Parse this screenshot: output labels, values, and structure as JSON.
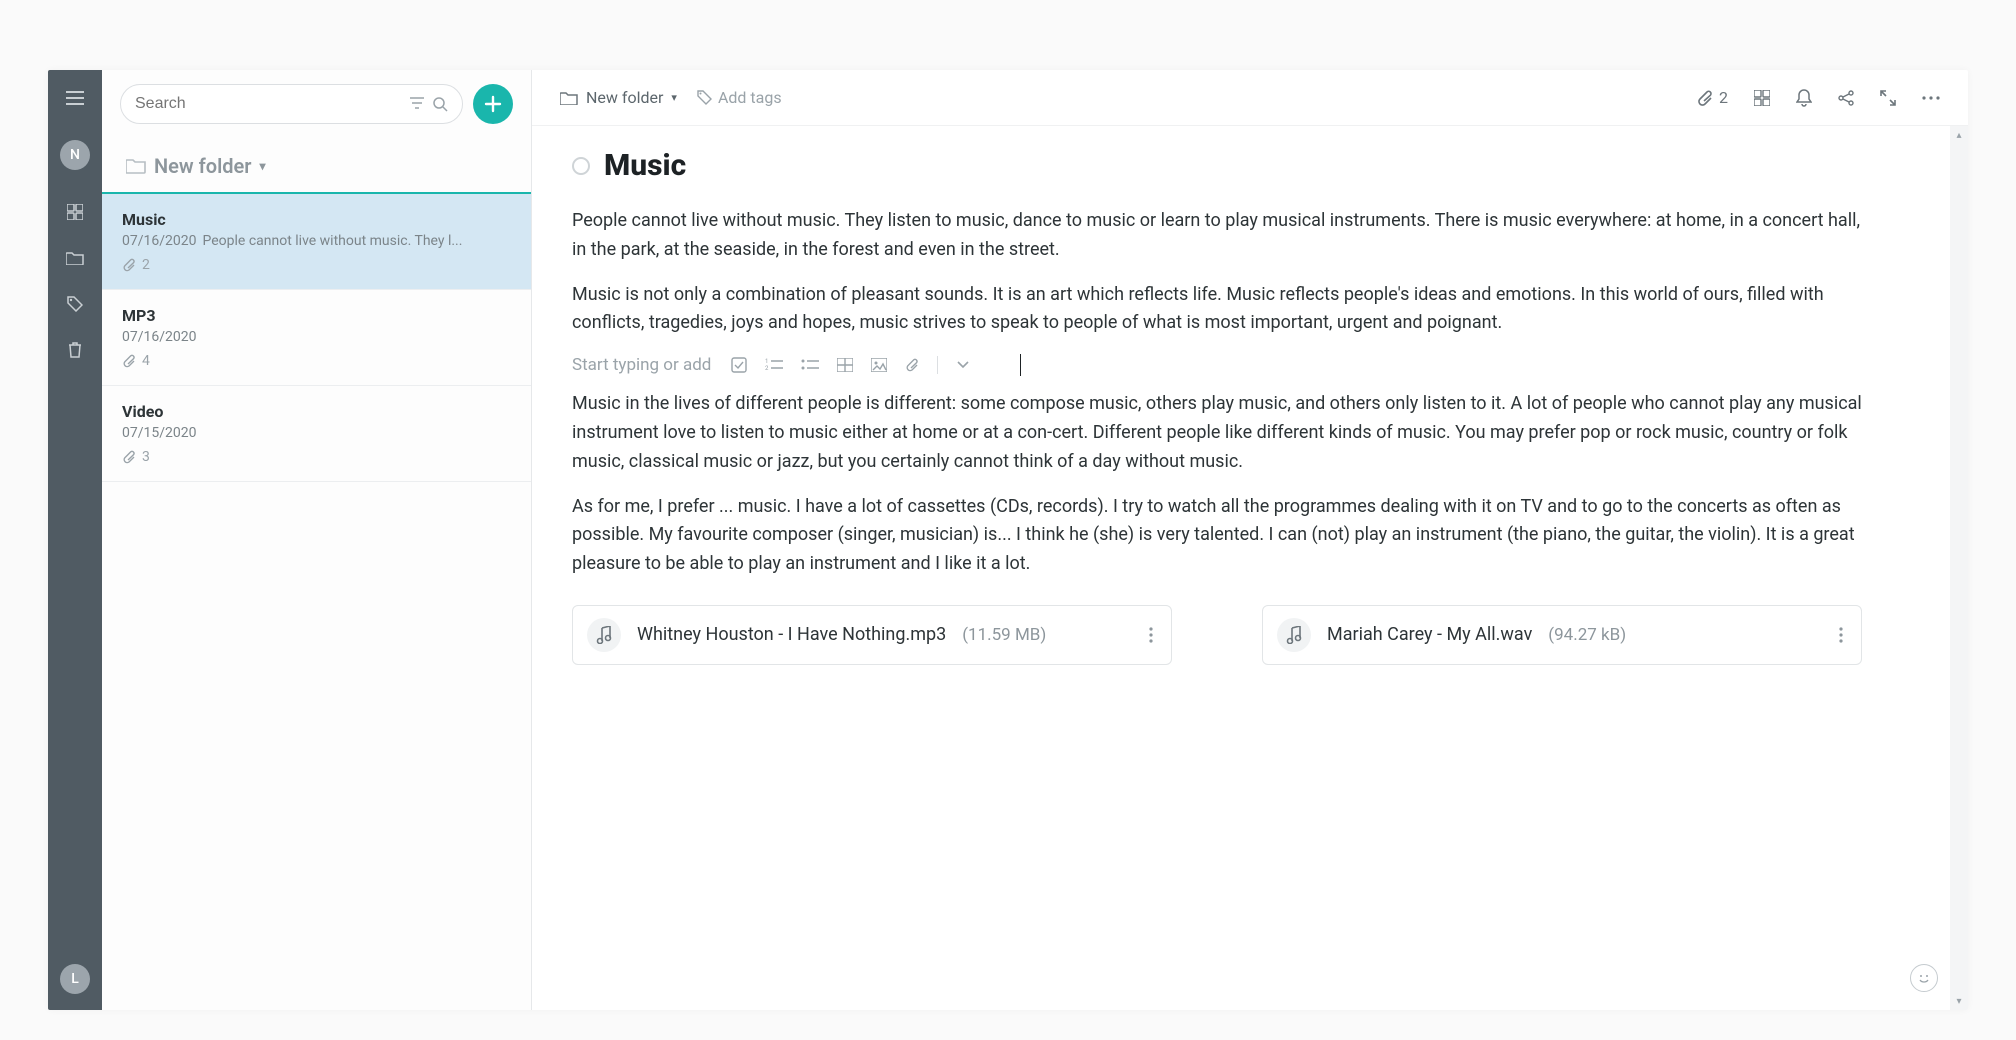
{
  "rail": {
    "top_avatar": "N",
    "bottom_avatar": "L"
  },
  "search": {
    "placeholder": "Search"
  },
  "folder_header": {
    "name": "New folder"
  },
  "notes": [
    {
      "title": "Music",
      "date": "07/16/2020",
      "preview": "People cannot live without music. They l...",
      "attachments": "2",
      "selected": true
    },
    {
      "title": "MP3",
      "date": "07/16/2020",
      "preview": "",
      "attachments": "4",
      "selected": false
    },
    {
      "title": "Video",
      "date": "07/15/2020",
      "preview": "",
      "attachments": "3",
      "selected": false
    }
  ],
  "editor": {
    "breadcrumb_folder": "New folder",
    "add_tags_label": "Add tags",
    "attachment_count": "2",
    "title": "Music",
    "paragraphs": [
      "People cannot live without music. They listen to music, dance to music or learn to play musical instruments. There is music everywhere: at home, in a concert hall, in the park, at the seaside, in the forest and even in the street.",
      "Music is not only a combination of pleasant sounds. It is an art which reflects life. Music reflects people's ideas and emotions. In this world of ours, filled with conflicts, tragedies, joys and hopes, music strives to speak to people of what is most important, urgent and poignant.",
      "Music in the lives of different people is different: some compose music, others play music, and others only listen to it. A lot of people who cannot play any musical instrument love to listen to music either at home or at a con-cert. Different people like different kinds of music. You may prefer pop or rock music, country or folk music, classical music or jazz, but you certainly cannot think of a day without music.",
      "As for me, I prefer ... music. I have a lot of cassettes (CDs, records). I try to watch all the programmes dealing with it on TV and to go to the concerts as often as possible. My favourite composer (singer, musician) is... I think he (she) is very talented. I can (not) play an instrument (the piano, the guitar, the violin). It is a great pleasure to be able to play an instrument and I like it a lot."
    ],
    "insert_placeholder": "Start typing or add",
    "attachments": [
      {
        "name": "Whitney Houston - I Have Nothing.mp3",
        "size": "(11.59 MB)"
      },
      {
        "name": "Mariah Carey - My All.wav",
        "size": "(94.27 kB)"
      }
    ]
  }
}
